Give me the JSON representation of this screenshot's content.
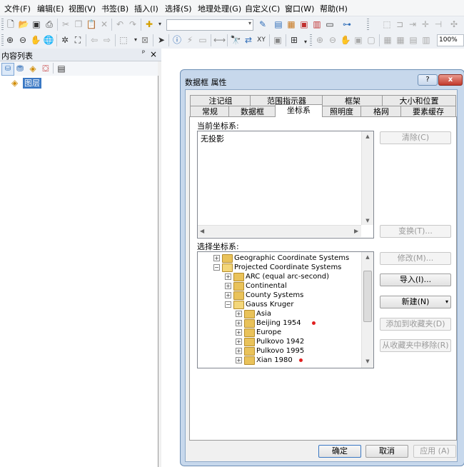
{
  "menu": [
    "文件(F)",
    "编辑(E)",
    "视图(V)",
    "书签(B)",
    "插入(I)",
    "选择(S)",
    "地理处理(G)",
    "自定义(C)",
    "窗口(W)",
    "帮助(H)"
  ],
  "toolbar": {
    "scale_value": "",
    "zoom_value": "100%"
  },
  "toc": {
    "title": "内容列表",
    "pin": "ᵖ",
    "close": "×",
    "layer_label": "图层"
  },
  "dialog": {
    "title": "数据框 属性",
    "help": "?",
    "close": "x",
    "tabs_row1": [
      "注记组",
      "范围指示器",
      "框架",
      "大小和位置"
    ],
    "tabs_row2": [
      "常规",
      "数据框",
      "坐标系",
      "照明度",
      "格网",
      "要素缓存"
    ],
    "active_tab": "坐标系",
    "current_cs_label": "当前坐标系:",
    "current_cs_value": "无投影",
    "btn_clear": "清除(C)",
    "btn_transform": "变换(T)...",
    "select_cs_label": "选择坐标系:",
    "btn_modify": "修改(M)...",
    "btn_import": "导入(I)...",
    "btn_new": "新建(N)",
    "btn_add_fav": "添加到收藏夹(D)",
    "btn_remove_fav": "从收藏夹中移除(R)",
    "btn_ok": "确定",
    "btn_cancel": "取消",
    "btn_apply": "应用 (A)",
    "tree": [
      {
        "label": "Geographic Coordinate Systems",
        "level": 1,
        "open": false,
        "dot": false
      },
      {
        "label": "Projected Coordinate Systems",
        "level": 1,
        "open": true,
        "dot": false
      },
      {
        "label": "ARC (equal arc-second)",
        "level": 2,
        "open": false,
        "dot": false
      },
      {
        "label": "Continental",
        "level": 2,
        "open": false,
        "dot": false
      },
      {
        "label": "County Systems",
        "level": 2,
        "open": false,
        "dot": false
      },
      {
        "label": "Gauss Kruger",
        "level": 2,
        "open": true,
        "dot": false
      },
      {
        "label": "Asia",
        "level": 3,
        "open": false,
        "dot": false
      },
      {
        "label": "Beijing 1954",
        "level": 3,
        "open": false,
        "dot": true
      },
      {
        "label": "Europe",
        "level": 3,
        "open": false,
        "dot": false
      },
      {
        "label": "Pulkovo 1942",
        "level": 3,
        "open": false,
        "dot": false
      },
      {
        "label": "Pulkovo 1995",
        "level": 3,
        "open": false,
        "dot": false
      },
      {
        "label": "Xian 1980",
        "level": 3,
        "open": false,
        "dot": true
      }
    ]
  },
  "colors": {
    "accent": "#3a78c4",
    "dot": "#e02020"
  }
}
